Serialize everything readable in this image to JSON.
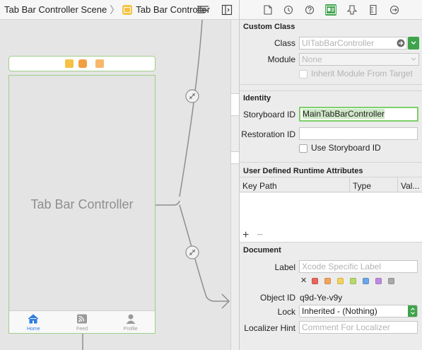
{
  "jumpbar": {
    "scene_crumb": "Tab Bar Controller Scene",
    "controller_crumb": "Tab Bar Controller",
    "separator": "〉"
  },
  "scene": {
    "title": "Tab Bar Controller",
    "tabs": [
      {
        "label": "Home",
        "icon": "home-icon",
        "active": true
      },
      {
        "label": "Feed",
        "icon": "rss-feed-icon",
        "active": false
      },
      {
        "label": "Profile",
        "icon": "person-icon",
        "active": false
      }
    ]
  },
  "inspector": {
    "tab_icons": [
      "file-icon",
      "history-icon",
      "help-icon",
      "identity-icon",
      "attributes-icon",
      "size-ruler-icon",
      "connections-arrow-icon"
    ],
    "custom_class": {
      "title": "Custom Class",
      "class_label": "Class",
      "class_placeholder": "UITabBarController",
      "module_label": "Module",
      "module_value": "None",
      "inherit_label": "Inherit Module From Target"
    },
    "identity": {
      "title": "Identity",
      "storyboard_id_label": "Storyboard ID",
      "storyboard_id_value": "MainTabBarController",
      "restoration_id_label": "Restoration ID",
      "restoration_id_value": "",
      "use_storyboard_id_label": "Use Storyboard ID"
    },
    "runtime_attributes": {
      "title": "User Defined Runtime Attributes",
      "columns": [
        "Key Path",
        "Type",
        "Val..."
      ],
      "add_label": "+",
      "remove_label": "−"
    },
    "document": {
      "title": "Document",
      "label_label": "Label",
      "label_placeholder": "Xcode Specific Label",
      "clear_symbol": "✕",
      "label_colors": [
        "#e8655a",
        "#f2a35c",
        "#f5d35a",
        "#b6da6a",
        "#6aa6e8",
        "#c08ae0",
        "#a9a9a9"
      ],
      "object_id_label": "Object ID",
      "object_id_value": "q9d-Ye-v9y",
      "lock_label": "Lock",
      "lock_value": "Inherited - (Nothing)",
      "localizer_label": "Localizer Hint",
      "localizer_placeholder": "Comment For Localizer"
    }
  },
  "colors": {
    "accent_green": "#3ea34a",
    "scene_border": "#9fcf8a",
    "tab_active": "#2f7de1",
    "focus_ring": "#7fcf6a"
  }
}
